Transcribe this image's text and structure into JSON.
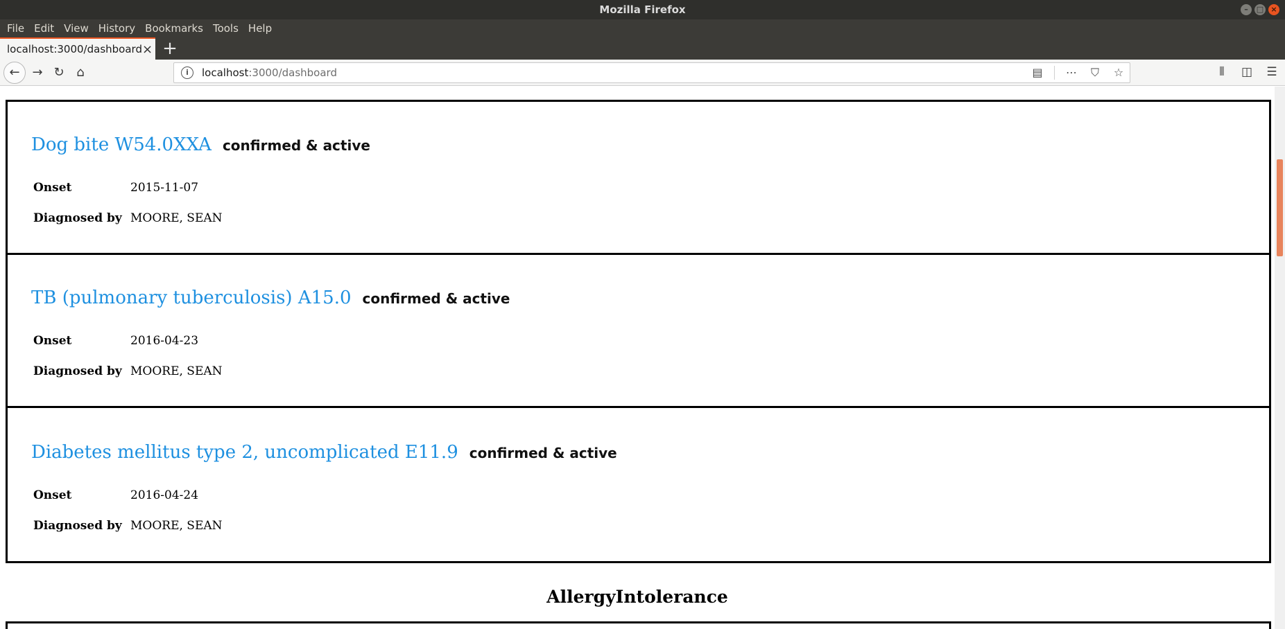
{
  "window": {
    "title": "Mozilla Firefox"
  },
  "menu": [
    "File",
    "Edit",
    "View",
    "History",
    "Bookmarks",
    "Tools",
    "Help"
  ],
  "tab": {
    "title": "localhost:3000/dashboard"
  },
  "url": {
    "host": "localhost",
    "path": ":3000/dashboard"
  },
  "conditions": [
    {
      "title": "Dog bite W54.0XXA",
      "status": "confirmed & active",
      "onset_label": "Onset",
      "onset": "2015-11-07",
      "diagnosed_label": "Diagnosed by",
      "diagnosed_by": "MOORE, SEAN"
    },
    {
      "title": "TB (pulmonary tuberculosis) A15.0",
      "status": "confirmed & active",
      "onset_label": "Onset",
      "onset": "2016-04-23",
      "diagnosed_label": "Diagnosed by",
      "diagnosed_by": "MOORE, SEAN"
    },
    {
      "title": "Diabetes mellitus type 2, uncomplicated E11.9",
      "status": "confirmed & active",
      "onset_label": "Onset",
      "onset": "2016-04-24",
      "diagnosed_label": "Diagnosed by",
      "diagnosed_by": "MOORE, SEAN"
    }
  ],
  "sections": {
    "allergy_heading": "AllergyIntolerance"
  },
  "colors": {
    "link": "#1e90e0",
    "accent": "#e95420",
    "scroll_thumb": "#e8845c"
  }
}
